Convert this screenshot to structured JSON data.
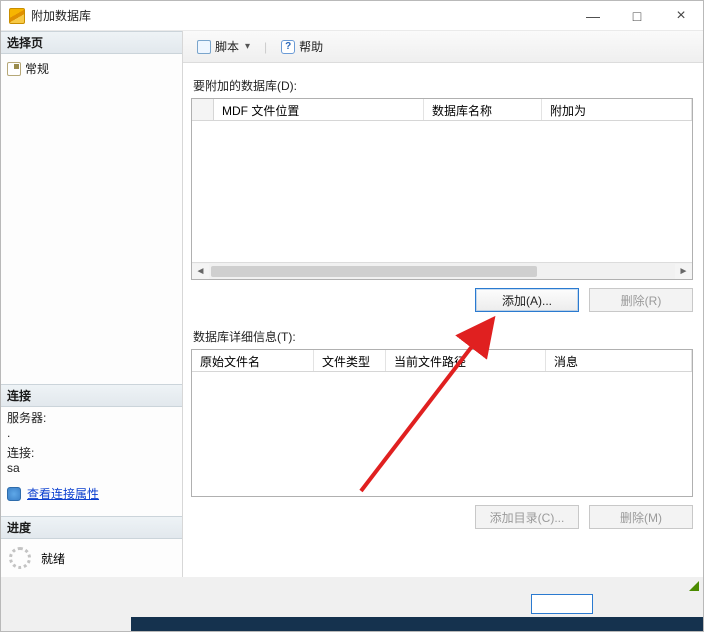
{
  "window": {
    "title": "附加数据库",
    "controls": {
      "minimize": "—",
      "maximize": "□",
      "close": "×"
    }
  },
  "left": {
    "select_page_header": "选择页",
    "general_item": "常规",
    "connection_header": "连接",
    "server_label": "服务器:",
    "server_value": ".",
    "conn_label": "连接:",
    "conn_value": "sa",
    "view_props_link": "查看连接属性",
    "progress_header": "进度",
    "progress_status": "就绪"
  },
  "toolbar": {
    "script_label": "脚本",
    "help_label": "帮助"
  },
  "main": {
    "attach_label": "要附加的数据库(D):",
    "grid1_cols": {
      "mdf": "MDF 文件位置",
      "dbname": "数据库名称",
      "attach_as": "附加为"
    },
    "btn_add": "添加(A)...",
    "btn_remove_top": "删除(R)",
    "details_label": "数据库详细信息(T):",
    "grid2_cols": {
      "orig": "原始文件名",
      "type": "文件类型",
      "path": "当前文件路径",
      "msg": "消息"
    },
    "btn_add_catalog": "添加目录(C)...",
    "btn_remove_bottom": "删除(M)"
  }
}
